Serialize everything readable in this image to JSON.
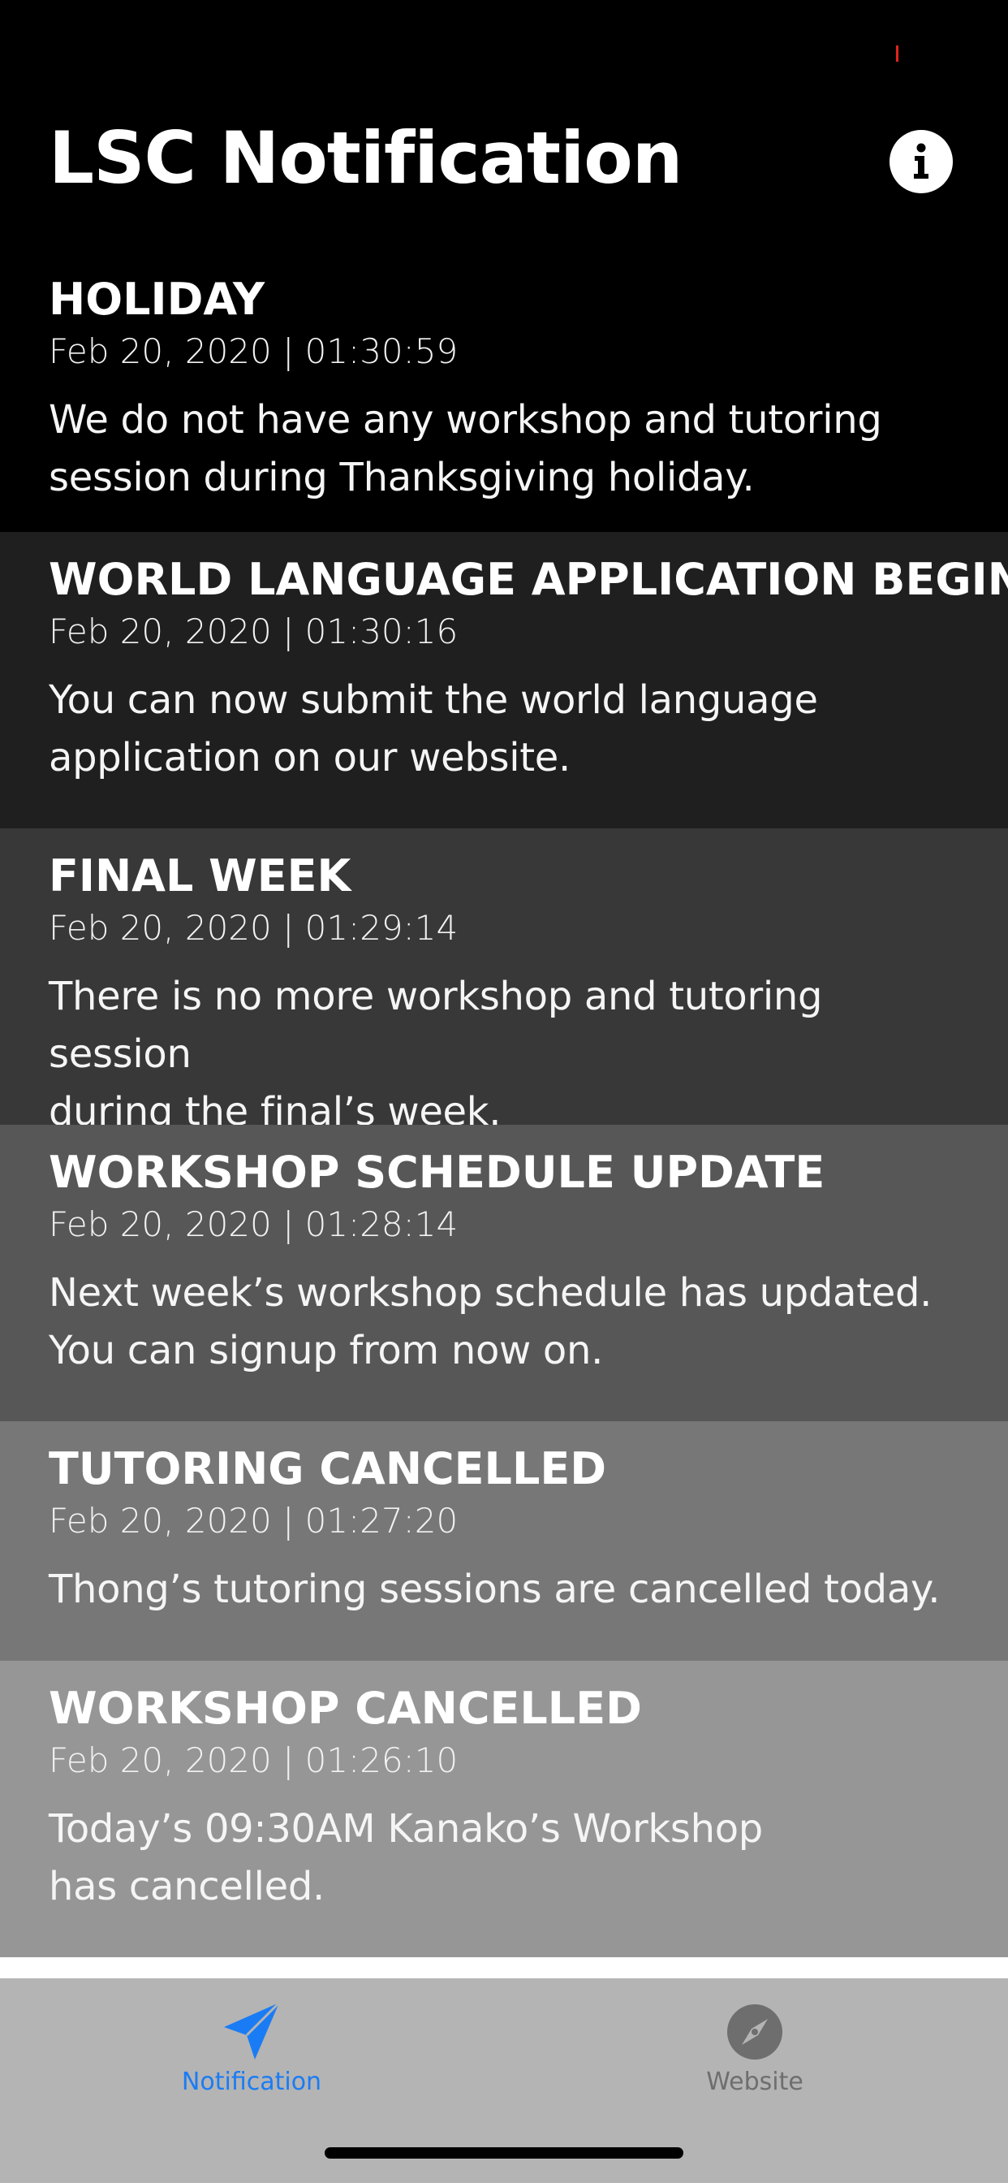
{
  "colors": {
    "accent": "#1a7cf5",
    "inactive": "#6e6e6e",
    "header_bg": "#000000",
    "tab_bar_bg": "#b4b4b4",
    "status_tick": "#e0241b",
    "card_backgrounds": [
      "#000000",
      "#1f1f1f",
      "#383838",
      "#575757",
      "#777777",
      "#969696"
    ]
  },
  "header": {
    "title": "LSC Notification",
    "info_icon": "info-icon"
  },
  "notifications": [
    {
      "title": "HOLIDAY",
      "date": "Feb 20, 2020 | 01:30:59",
      "body_lines": [
        "We do not have any workshop and tutoring",
        "session during Thanksgiving holiday."
      ]
    },
    {
      "title": "WORLD LANGUAGE APPLICATION BEGIN",
      "date": "Feb 20, 2020 | 01:30:16",
      "body_lines": [
        "You can now submit the world language",
        "application on our website."
      ]
    },
    {
      "title": "FINAL WEEK",
      "date": "Feb 20, 2020 | 01:29:14",
      "body_lines": [
        "There is no more workshop and tutoring session",
        "during the final’s week."
      ]
    },
    {
      "title": "WORKSHOP SCHEDULE UPDATE",
      "date": "Feb 20, 2020 | 01:28:14",
      "body_lines": [
        "Next week’s workshop schedule has updated.",
        "You can signup from now on."
      ]
    },
    {
      "title": "TUTORING CANCELLED",
      "date": "Feb 20, 2020 | 01:27:20",
      "body_lines": [
        "Thong’s tutoring sessions are cancelled today."
      ]
    },
    {
      "title": "WORKSHOP CANCELLED",
      "date": "Feb 20, 2020 | 01:26:10",
      "body_lines": [
        "Today’s 09:30AM Kanako’s Workshop",
        "has cancelled."
      ]
    }
  ],
  "tab_bar": {
    "tabs": [
      {
        "label": "Notification",
        "icon": "paper-plane-icon",
        "selected": true
      },
      {
        "label": "Website",
        "icon": "compass-icon",
        "selected": false
      }
    ]
  }
}
